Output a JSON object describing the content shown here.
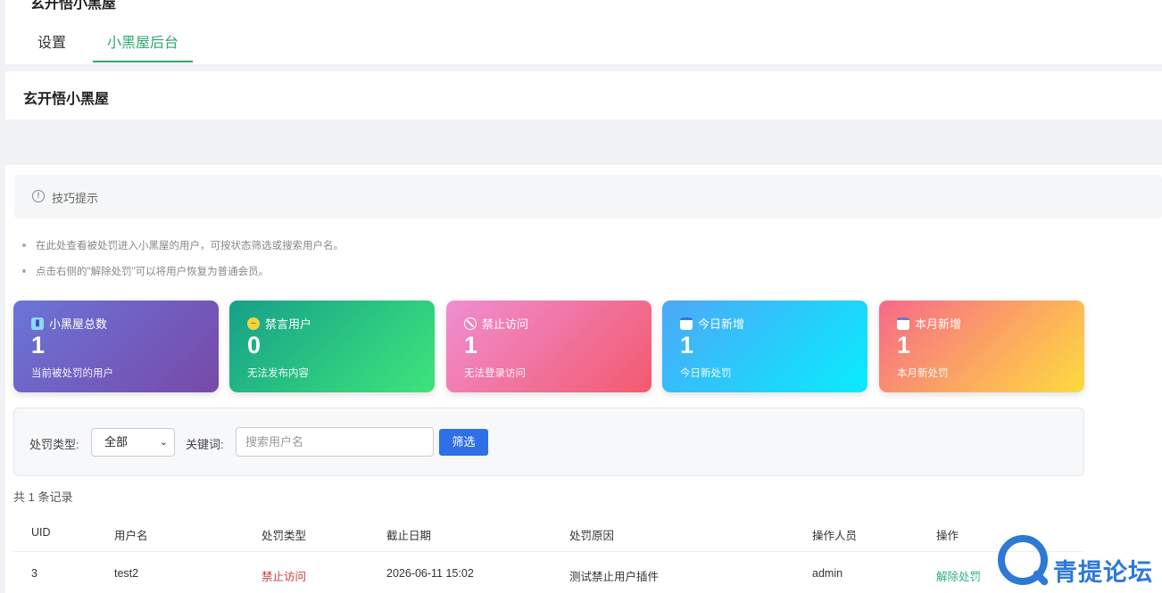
{
  "header": {
    "cut_title": "玄开悟小黑屋",
    "tabs": [
      {
        "label": "设置"
      },
      {
        "label": "小黑屋后台"
      }
    ]
  },
  "page_title": "玄开悟小黑屋",
  "tips": {
    "title": "技巧提示",
    "lines": [
      "在此处查看被处罚进入小黑屋的用户，可按状态筛选或搜索用户名。",
      "点击右侧的\"解除处罚\"可以将用户恢复为普通会员。"
    ]
  },
  "stats": [
    {
      "label": "小黑屋总数",
      "value": "1",
      "desc": "当前被处罚的用户",
      "icon": "chart-icon"
    },
    {
      "label": "禁言用户",
      "value": "0",
      "desc": "无法发布内容",
      "icon": "muted-face-icon"
    },
    {
      "label": "禁止访问",
      "value": "1",
      "desc": "无法登录访问",
      "icon": "ban-icon"
    },
    {
      "label": "今日新增",
      "value": "1",
      "desc": "今日新处罚",
      "icon": "calendar-icon"
    },
    {
      "label": "本月新增",
      "value": "1",
      "desc": "本月新处罚",
      "icon": "calendar-icon"
    }
  ],
  "filter": {
    "type_label": "处罚类型:",
    "type_value": "全部",
    "keyword_label": "关键词:",
    "keyword_placeholder": "搜索用户名",
    "button": "筛选"
  },
  "total_text": "共 1 条记录",
  "table": {
    "headers": [
      "UID",
      "用户名",
      "处罚类型",
      "截止日期",
      "处罚原因",
      "操作人员",
      "操作"
    ],
    "rows": [
      [
        "3",
        "test2",
        "禁止访问",
        "2026-06-11 15:02",
        "测试禁止用户插件",
        "admin",
        "解除处罚"
      ]
    ]
  },
  "watermark": "青提论坛",
  "colors": {
    "accent_green": "#2da76f",
    "button_blue": "#2f6fe8",
    "danger_red": "#d63b3b"
  }
}
